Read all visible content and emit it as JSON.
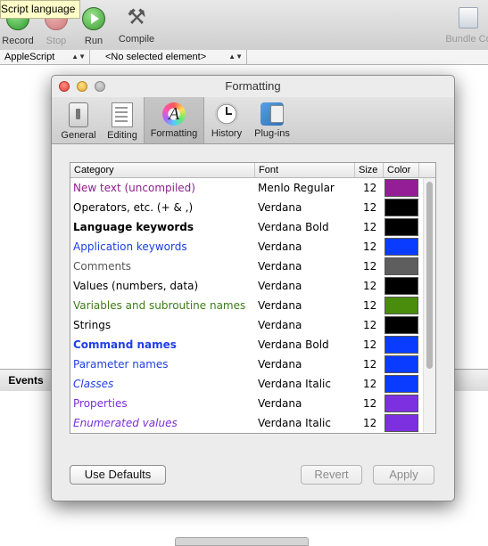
{
  "toolbar": {
    "record_label": "Record",
    "stop_label": "Stop",
    "run_label": "Run",
    "compile_label": "Compile",
    "bundle_label": "Bundle Co"
  },
  "tooltip": {
    "text": "Script language"
  },
  "navbar": {
    "language": "AppleScript",
    "element": "<No selected element>"
  },
  "bottom": {
    "tab_label": "Events"
  },
  "panel": {
    "title": "Formatting",
    "tabs": [
      {
        "label": "General",
        "icon": "general-switch-icon"
      },
      {
        "label": "Editing",
        "icon": "editing-document-icon"
      },
      {
        "label": "Formatting",
        "icon": "formatting-color-wheel-icon",
        "selected": true
      },
      {
        "label": "History",
        "icon": "history-clock-icon"
      },
      {
        "label": "Plug-ins",
        "icon": "plugins-globe-icon"
      }
    ],
    "columns": {
      "category": "Category",
      "font": "Font",
      "size": "Size",
      "color": "Color"
    },
    "rows": [
      {
        "category": "New text (uncompiled)",
        "font": "Menlo Regular",
        "size": "12",
        "text_color": "#8e1f8c",
        "weight": "normal",
        "style": "normal",
        "swatch": "#941e95"
      },
      {
        "category": "Operators, etc. (+ & ,)",
        "font": "Verdana",
        "size": "12",
        "text_color": "#000000",
        "weight": "normal",
        "style": "normal",
        "swatch": "#000000"
      },
      {
        "category": "Language keywords",
        "font": "Verdana Bold",
        "size": "12",
        "text_color": "#000000",
        "weight": "bold",
        "style": "normal",
        "swatch": "#000000"
      },
      {
        "category": "Application keywords",
        "font": "Verdana",
        "size": "12",
        "text_color": "#1a3ee0",
        "weight": "normal",
        "style": "normal",
        "swatch": "#0a3cff"
      },
      {
        "category": "Comments",
        "font": "Verdana",
        "size": "12",
        "text_color": "#555555",
        "weight": "normal",
        "style": "normal",
        "swatch": "#5e5e5e"
      },
      {
        "category": "Values (numbers, data)",
        "font": "Verdana",
        "size": "12",
        "text_color": "#000000",
        "weight": "normal",
        "style": "normal",
        "swatch": "#000000"
      },
      {
        "category": "Variables and subroutine names",
        "font": "Verdana",
        "size": "12",
        "text_color": "#3c7d18",
        "weight": "normal",
        "style": "normal",
        "swatch": "#4a8d0d"
      },
      {
        "category": "Strings",
        "font": "Verdana",
        "size": "12",
        "text_color": "#000000",
        "weight": "normal",
        "style": "normal",
        "swatch": "#000000"
      },
      {
        "category": "Command names",
        "font": "Verdana Bold",
        "size": "12",
        "text_color": "#1f3fe6",
        "weight": "bold",
        "style": "normal",
        "swatch": "#0a3cff"
      },
      {
        "category": "Parameter names",
        "font": "Verdana",
        "size": "12",
        "text_color": "#1f3fe6",
        "weight": "normal",
        "style": "normal",
        "swatch": "#0a3cff"
      },
      {
        "category": "Classes",
        "font": "Verdana Italic",
        "size": "12",
        "text_color": "#1f3fe6",
        "weight": "normal",
        "style": "italic",
        "swatch": "#0a3cff"
      },
      {
        "category": "Properties",
        "font": "Verdana",
        "size": "12",
        "text_color": "#7a2fd6",
        "weight": "normal",
        "style": "normal",
        "swatch": "#7d30df"
      },
      {
        "category": "Enumerated values",
        "font": "Verdana Italic",
        "size": "12",
        "text_color": "#7a2fd6",
        "weight": "normal",
        "style": "italic",
        "swatch": "#7d30df"
      }
    ],
    "buttons": {
      "use_defaults": "Use Defaults",
      "revert": "Revert",
      "apply": "Apply"
    }
  }
}
